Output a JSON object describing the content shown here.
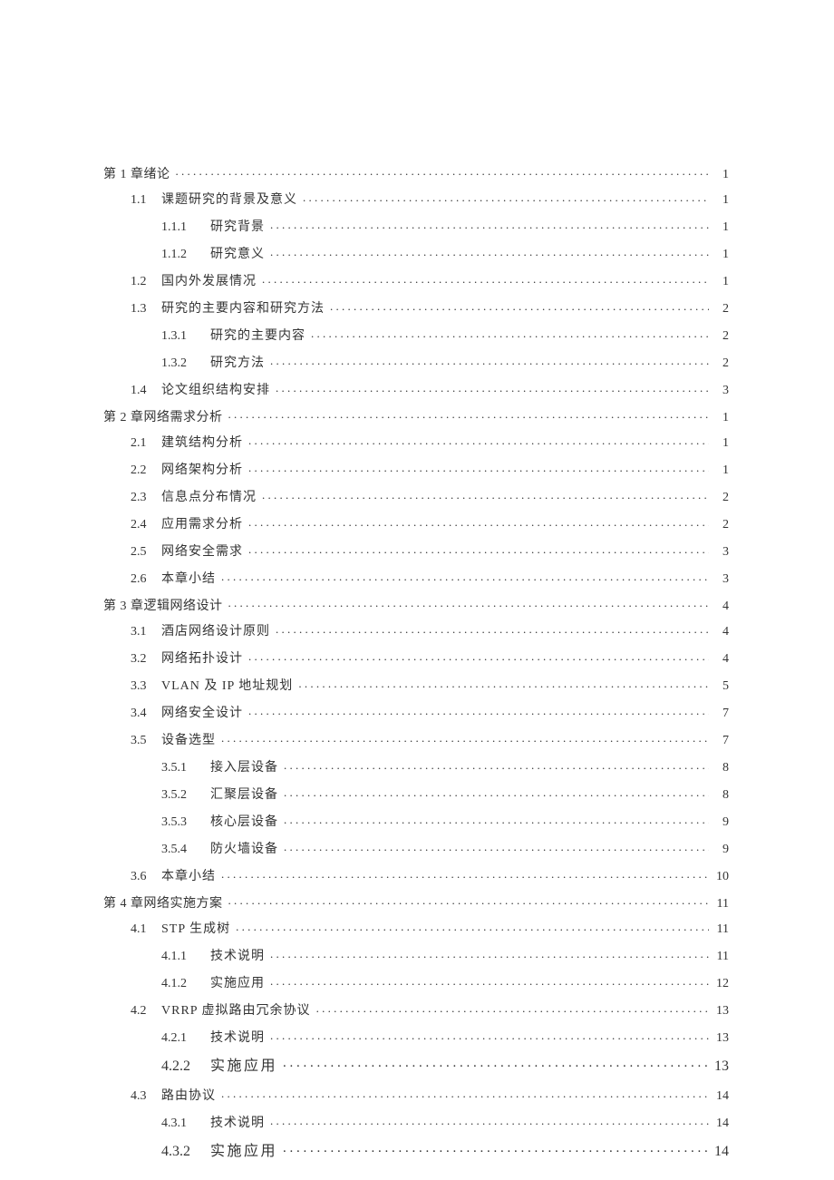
{
  "toc": {
    "ch1": {
      "label": "第 1 章绪论",
      "page": "1"
    },
    "s1_1": {
      "num": "1.1",
      "label": "课题研究的背景及意义",
      "page": "1"
    },
    "s1_1_1": {
      "num": "1.1.1",
      "label": "研究背景",
      "page": "1"
    },
    "s1_1_2": {
      "num": "1.1.2",
      "label": "研究意义",
      "page": "1"
    },
    "s1_2": {
      "num": "1.2",
      "label": "国内外发展情况",
      "page": "1"
    },
    "s1_3": {
      "num": "1.3",
      "label": "研究的主要内容和研究方法",
      "page": "2"
    },
    "s1_3_1": {
      "num": "1.3.1",
      "label": "研究的主要内容",
      "page": "2"
    },
    "s1_3_2": {
      "num": "1.3.2",
      "label": "研究方法",
      "page": "2"
    },
    "s1_4": {
      "num": "1.4",
      "label": "论文组织结构安排",
      "page": "3"
    },
    "ch2": {
      "label": "第 2 章网络需求分析",
      "page": "1"
    },
    "s2_1": {
      "num": "2.1",
      "label": "建筑结构分析",
      "page": "1"
    },
    "s2_2": {
      "num": "2.2",
      "label": "网络架构分析",
      "page": "1"
    },
    "s2_3": {
      "num": "2.3",
      "label": "信息点分布情况",
      "page": "2"
    },
    "s2_4": {
      "num": "2.4",
      "label": "应用需求分析",
      "page": "2"
    },
    "s2_5": {
      "num": "2.5",
      "label": "网络安全需求",
      "page": "3"
    },
    "s2_6": {
      "num": "2.6",
      "label": "本章小结",
      "page": "3"
    },
    "ch3": {
      "label": "第 3 章逻辑网络设计",
      "page": "4"
    },
    "s3_1": {
      "num": "3.1",
      "label": "酒店网络设计原则",
      "page": "4"
    },
    "s3_2": {
      "num": "3.2",
      "label": "网络拓扑设计",
      "page": "4"
    },
    "s3_3": {
      "num": "3.3",
      "label": "VLAN 及 IP 地址规划",
      "page": "5"
    },
    "s3_4": {
      "num": "3.4",
      "label": "网络安全设计",
      "page": "7"
    },
    "s3_5": {
      "num": "3.5",
      "label": "设备选型",
      "page": "7"
    },
    "s3_5_1": {
      "num": "3.5.1",
      "label": "接入层设备",
      "page": "8"
    },
    "s3_5_2": {
      "num": "3.5.2",
      "label": "汇聚层设备",
      "page": "8"
    },
    "s3_5_3": {
      "num": "3.5.3",
      "label": "核心层设备",
      "page": "9"
    },
    "s3_5_4": {
      "num": "3.5.4",
      "label": "防火墙设备",
      "page": "9"
    },
    "s3_6": {
      "num": "3.6",
      "label": "本章小结",
      "page": "10"
    },
    "ch4": {
      "label": "第 4 章网络实施方案",
      "page": "11"
    },
    "s4_1": {
      "num": "4.1",
      "label": "STP 生成树",
      "page": "11"
    },
    "s4_1_1": {
      "num": "4.1.1",
      "label": "技术说明",
      "page": "11"
    },
    "s4_1_2": {
      "num": "4.1.2",
      "label": "实施应用",
      "page": "12"
    },
    "s4_2": {
      "num": "4.2",
      "label": "VRRP 虚拟路由冗余协议",
      "page": "13"
    },
    "s4_2_1": {
      "num": "4.2.1",
      "label": "技术说明",
      "page": "13"
    },
    "s4_2_2": {
      "num": "4.2.2",
      "label": "实施应用",
      "page": "13"
    },
    "s4_3": {
      "num": "4.3",
      "label": "路由协议",
      "page": "14"
    },
    "s4_3_1": {
      "num": "4.3.1",
      "label": "技术说明",
      "page": "14"
    },
    "s4_3_2": {
      "num": "4.3.2",
      "label": "实施应用",
      "page": "14"
    }
  }
}
